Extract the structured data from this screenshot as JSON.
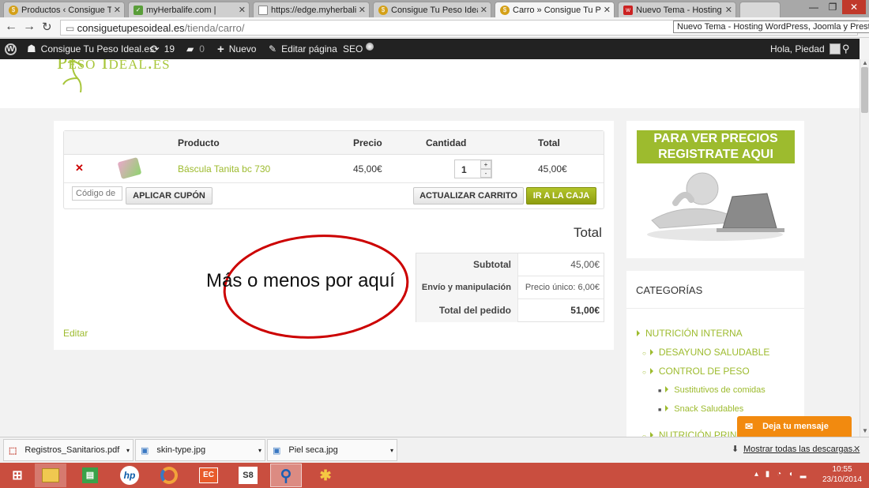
{
  "browser": {
    "tabs": [
      {
        "title": "Productos ‹ Consigue Tu Pes",
        "favicon_color": "#d4a017",
        "active": false
      },
      {
        "title": "myHerbalife.com |",
        "favicon_color": "#5a9e3a",
        "active": false
      },
      {
        "title": "https://edge.myherbalife.",
        "favicon_color": "#888888",
        "active": false
      },
      {
        "title": "Consigue Tu Peso Ideal.es",
        "favicon_color": "#d4a017",
        "active": false
      },
      {
        "title": "Carro » Consigue Tu Peso",
        "favicon_color": "#d4a017",
        "active": true
      },
      {
        "title": "Nuevo Tema - Hosting Wo",
        "favicon_color": "#cc2222",
        "active": false
      }
    ],
    "url_host": "consiguetupesoideal.es",
    "url_path": "/tienda/carro/",
    "tooltip": "Nuevo Tema - Hosting WordPress, Joomla y PrestaShop"
  },
  "adminbar": {
    "site_name": "Consigue Tu Peso Ideal.es",
    "updates_count": "19",
    "comments_count": "0",
    "new_label": "Nuevo",
    "edit_label": "Editar página",
    "seo_label": "SEO",
    "greeting": "Hola, Piedad"
  },
  "site": {
    "logo_text": "Peso Ideal.es"
  },
  "cart": {
    "headers": {
      "product": "Producto",
      "price": "Precio",
      "quantity": "Cantidad",
      "total": "Total"
    },
    "items": [
      {
        "name": "Báscula Tanita bc 730",
        "price": "45,00€",
        "quantity": "1",
        "total": "45,00€"
      }
    ],
    "coupon_placeholder": "Código de",
    "apply_coupon": "APLICAR CUPÓN",
    "update_cart": "ACTUALIZAR CARRITO",
    "checkout": "IR A LA CAJA",
    "totals_title": "Total",
    "subtotal_label": "Subtotal",
    "subtotal_value": "45,00€",
    "shipping_label": "Envío y manipulación",
    "shipping_value": "Precio único: 6,00€",
    "order_total_label": "Total del pedido",
    "order_total_value": "51,00€",
    "edit_link": "Editar"
  },
  "annotation": {
    "text": "Más o menos por aquí",
    "color": "#cc0000"
  },
  "sidebar": {
    "ad_line1": "PARA VER PRECIOS",
    "ad_line2": "REGISTRATE AQUI",
    "categories_title": "CATEGORÍAS",
    "categories": [
      {
        "label": "NUTRICIÓN INTERNA",
        "level": 0
      },
      {
        "label": "DESAYUNO SALUDABLE",
        "level": 1
      },
      {
        "label": "CONTROL DE PESO",
        "level": 1
      },
      {
        "label": "Sustitutivos de comidas",
        "level": 2
      },
      {
        "label": "Snack Saludables",
        "level": 2
      },
      {
        "label": "NUTRICIÓN PRINC",
        "level": 1
      }
    ],
    "message_button": "Deja tu mensaje"
  },
  "downloads": {
    "items": [
      "Registros_Sanitarios.pdf",
      "skin-type.jpg",
      "Piel seca.jpg"
    ],
    "show_all": "Mostrar todas las descargas..."
  },
  "taskbar": {
    "time": "10:55",
    "date": "23/10/2014"
  },
  "colors": {
    "accent_green": "#9dbb2e",
    "checkout_green": "#a0b21d",
    "adminbar_bg": "#222222",
    "taskbar_bg": "#c94e3f",
    "chat_orange": "#f28a0f"
  }
}
